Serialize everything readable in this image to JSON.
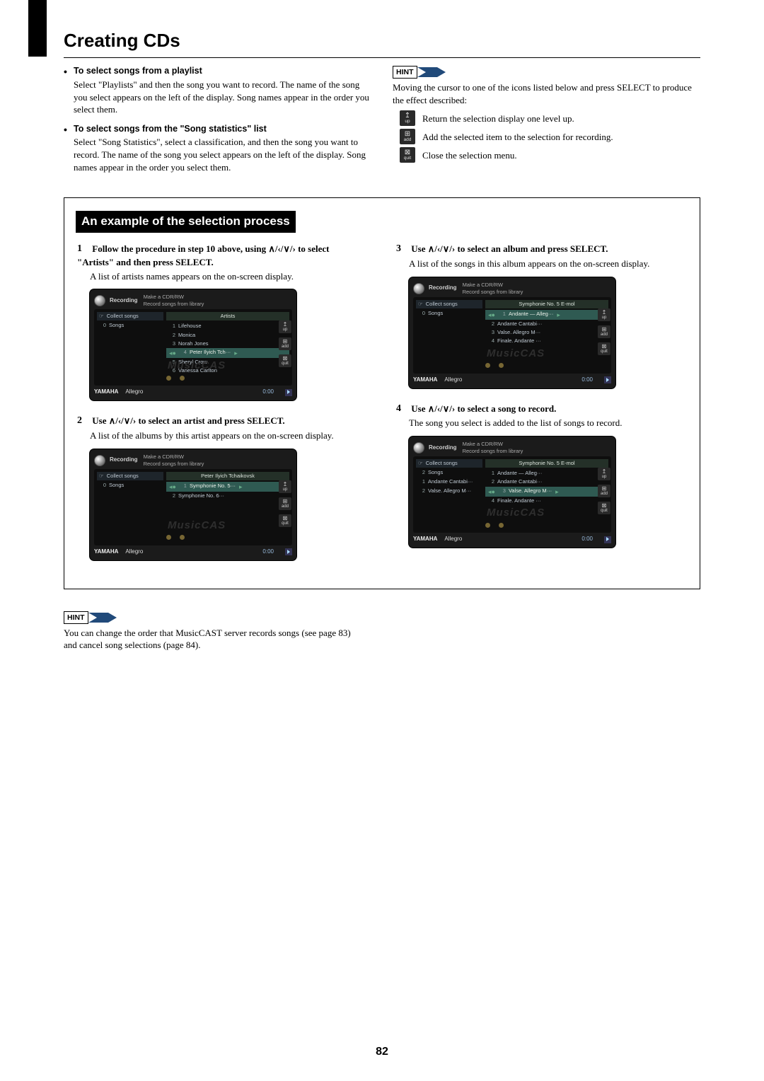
{
  "page_title": "Creating CDs",
  "page_number": "82",
  "bullets": {
    "a_head": "To select songs from a playlist",
    "a_body": "Select \"Playlists\" and then the song you want to record. The name of the song you select appears on the left of the display. Song names appear in the order you select them.",
    "b_head": "To select songs from the \"Song statistics\" list",
    "b_body": "Select \"Song Statistics\", select a classification, and then the song you want to record. The name of the song you select appears on the left of the display. Song names appear in the order you select them."
  },
  "hint1_label": "HINT",
  "hint1_text": "Moving the cursor to one of the icons listed below and press SELECT to produce the effect described:",
  "hint1_rows": {
    "up": "Return the selection display one level up.",
    "add": "Add the selected item to the selection for recording.",
    "quit": "Close the selection menu."
  },
  "icon_labels": {
    "up": "up",
    "add": "add",
    "quit": "quit"
  },
  "example_heading": "An example of the selection process",
  "steps": {
    "s1_head": "Follow the procedure in step 10 above, using ∧/‹/∨/› to select \"Artists\" and then press SELECT.",
    "s1_body": "A list of artists names appears on the on-screen display.",
    "s2_head": "Use ∧/‹/∨/› to select an artist and press SELECT.",
    "s2_body": "A list of the albums by this artist appears on the on-screen display.",
    "s3_head": "Use ∧/‹/∨/› to select an album and press SELECT.",
    "s3_body": "A list of the songs in this album appears on the on-screen display.",
    "s4_head": "Use ∧/‹/∨/› to select a song to record.",
    "s4_body": "The song you select is added to the list of songs to record."
  },
  "dev_common": {
    "hdr_mode": "Recording",
    "hdr_line1": "Make a CDR/RW",
    "hdr_line2": "Record songs from library",
    "left_collect": "Collect songs",
    "left_songs": "Songs",
    "footer_brand": "YAMAHA",
    "footer_now": "Allegro",
    "footer_time": "0:00",
    "watermark": "MusicCAS"
  },
  "dev1": {
    "left_count": "0",
    "right_title": "Artists",
    "rows": [
      "Lifehouse",
      "Monica",
      "Norah Jones",
      "Peter Ilyich Tch···",
      "Sheryl Crow",
      "Vanessa Carlton"
    ],
    "sel_index": 3
  },
  "dev2": {
    "left_count": "0",
    "right_title": "Peter Ilyich Tchaikovsk",
    "rows": [
      "Symphonie No. 5···",
      "Symphonie No. 6···"
    ],
    "sel_index": 0
  },
  "dev3": {
    "left_count": "0",
    "right_title": "Symphonie No. 5 E-mol",
    "rows": [
      "Andante — Alleg···",
      "Andante Cantabi···",
      "Valse. Allegro M···",
      "Finale. Andante ···"
    ],
    "sel_index": 0
  },
  "dev4": {
    "left_count": "2",
    "left_items": [
      "Andante Cantabi···",
      "Valse. Allegro M···"
    ],
    "right_title": "Symphonie No. 5 E-mol",
    "rows": [
      "Andante — Alleg···",
      "Andante Cantabi···",
      "Valse. Allegro M···",
      "Finale. Andante ···"
    ],
    "sel_index": 2
  },
  "hint2_label": "HINT",
  "hint2_text": "You can change the order that MusicCAST server records songs (see page 83) and cancel song selections (page 84)."
}
